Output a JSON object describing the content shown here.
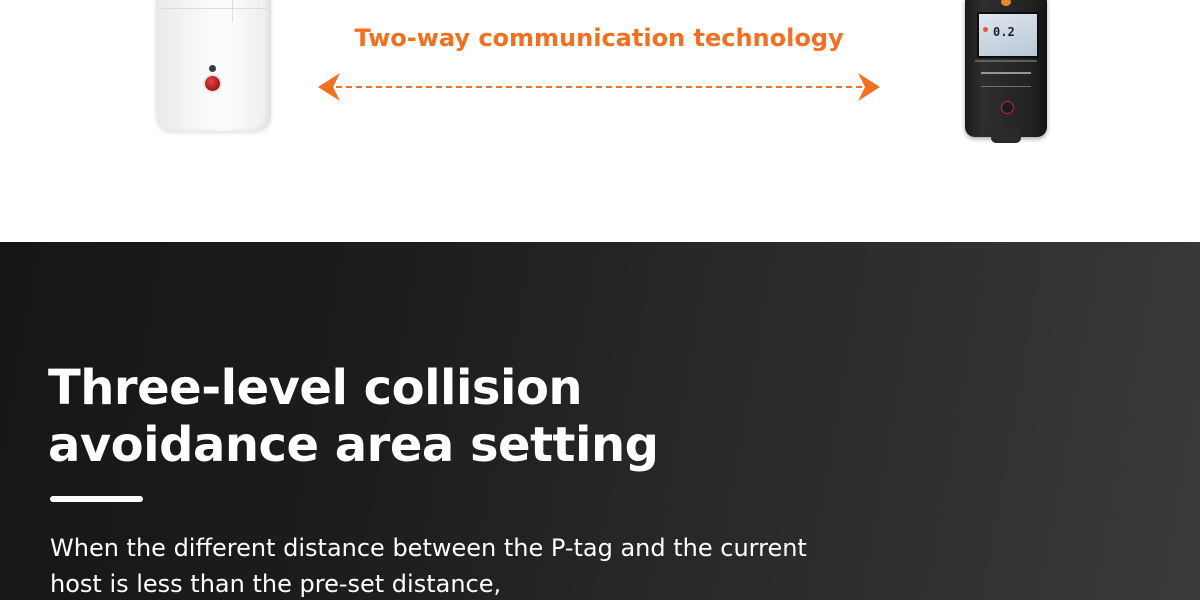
{
  "top_section": {
    "communication_label": "Two-way communication technology",
    "accent_color": "#f37021",
    "left_device": {
      "icon": "p-tag-icon",
      "description_label": ""
    },
    "right_device": {
      "icon": "host-device-icon",
      "screen_reading": "0.2"
    }
  },
  "feature": {
    "headline_line1": "Three-level collision",
    "headline_line2": "avoidance area setting",
    "body_line1": "When the different distance between the P-tag and the current",
    "body_line2": "host is less than the pre-set distance,"
  },
  "colors": {
    "dark_background": "#1c1c1c",
    "text_light": "#ffffff"
  }
}
